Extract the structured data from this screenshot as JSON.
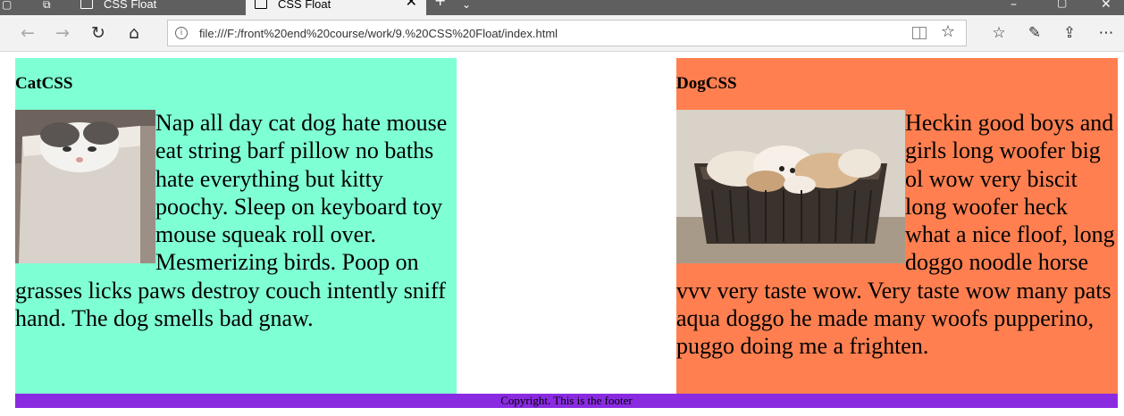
{
  "browser": {
    "tabs": [
      {
        "title": "CSS Float",
        "active": false
      },
      {
        "title": "CSS Float",
        "active": true
      }
    ],
    "address_bar": {
      "url": "file:///F:/front%20end%20course/work/9.%20CSS%20Float/index.html"
    }
  },
  "page": {
    "cat": {
      "heading": "CatCSS",
      "text": "Nap all day cat dog hate mouse eat string barf pillow no baths hate everything but kitty poochy. Sleep on keyboard toy mouse squeak roll over. Mesmerizing birds. Poop on grasses licks paws destroy couch intently sniff hand. The dog smells bad gnaw.",
      "background": "#7fffd4"
    },
    "dog": {
      "heading": "DogCSS",
      "text": "Heckin good boys and girls long woofer big ol wow very biscit long woofer heck what a nice floof, long doggo noodle horse vvv very taste wow. Very taste wow many pats aqua doggo he made many woofs pupperino, puggo doing me a frighten.",
      "background": "#ff7f50"
    },
    "footer": {
      "text": "Copyright. This is the footer",
      "background": "#8a2be2"
    }
  }
}
